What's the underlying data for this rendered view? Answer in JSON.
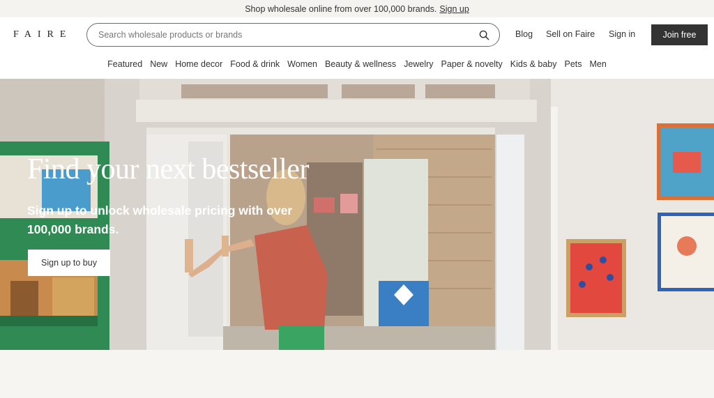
{
  "promo": {
    "text": "Shop wholesale online from over 100,000 brands.",
    "link": "Sign up"
  },
  "header": {
    "logo": "FAIRE",
    "search_placeholder": "Search wholesale products or brands",
    "search_icon": "search-icon",
    "links": {
      "blog": "Blog",
      "sell": "Sell on Faire",
      "signin": "Sign in"
    },
    "join_label": "Join free"
  },
  "categories": [
    "Featured",
    "New",
    "Home decor",
    "Food & drink",
    "Women",
    "Beauty & wellness",
    "Jewelry",
    "Paper & novelty",
    "Kids & baby",
    "Pets",
    "Men"
  ],
  "hero": {
    "title": "Find your next bestseller",
    "subtitle": "Sign up to unlock wholesale pricing with over 100,000 brands.",
    "button": "Sign up to buy"
  },
  "colors": {
    "primary_button": "#333333",
    "promo_bg": "#f5f3ef",
    "page_bg": "#f7f5f2"
  }
}
